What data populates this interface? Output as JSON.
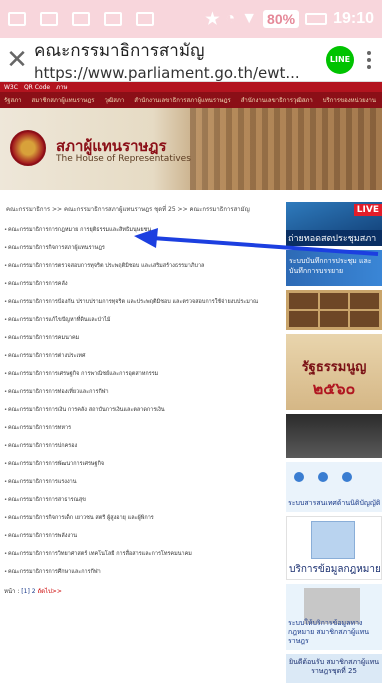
{
  "status_bar": {
    "battery": "80%",
    "time": "19:10"
  },
  "browser": {
    "page_title": "คณะกรรมาธิการสามัญ",
    "url": "https://www.parliament.go.th/ewt...",
    "line_label": "LINE"
  },
  "site": {
    "util_links": [
      "W3C",
      "QR Code",
      "ภาษ"
    ],
    "nav_items": [
      "รัฐสภา",
      "สมาชิกสภาผู้แทนราษฎร",
      "วุฒิสภา",
      "สำนักงานเลขาธิการสภาผู้แทนราษฎร",
      "สำนักงานเลขาธิการวุฒิสภา",
      "บริการของหน่วยงาน"
    ],
    "banner_th": "สภาผู้แทนราษฎร",
    "banner_en": "The House of Representatives",
    "breadcrumb": "คณะกรรมาธิการ >> คณะกรรมาธิการสภาผู้แทนราษฎร ชุดที่ 25 >> คณะกรรมาธิการสามัญ"
  },
  "committees": [
    "คณะกรรมาธิการการกฎหมาย การยุติธรรมและสิทธิมนุษยชน",
    "คณะกรรมาธิการกิจการสภาผู้แทนราษฎร",
    "คณะกรรมาธิการการตรวจสอบการทุจริต ประพฤติมิชอบ และเสริมสร้างธรรมาภิบาล",
    "คณะกรรมาธิการการคลัง",
    "คณะกรรมาธิการการป้องกัน ปราบปรามการทุจริต และประพฤติมิชอบ และตรวจสอบการใช้จ่ายงบประมาณ",
    "คณะกรรมาธิการแก้ไขปัญหาที่ดินและป่าไม้",
    "คณะกรรมาธิการการคมนาคม",
    "คณะกรรมาธิการการต่างประเทศ",
    "คณะกรรมาธิการการเศรษฐกิจ การพาณิชย์และการอุตสาหกรรม",
    "คณะกรรมาธิการการท่องเที่ยวและการกีฬา",
    "คณะกรรมาธิการการเงิน การคลัง สถาบันการเงินและตลาดการเงิน",
    "คณะกรรมาธิการการทหาร",
    "คณะกรรมาธิการการปกครอง",
    "คณะกรรมาธิการการพัฒนาการเศรษฐกิจ",
    "คณะกรรมาธิการการแรงงาน",
    "คณะกรรมาธิการการสาธารณสุข",
    "คณะกรรมาธิการกิจการเด็ก เยาวชน สตรี ผู้สูงอายุ และผู้พิการ",
    "คณะกรรมาธิการการพลังงาน",
    "คณะกรรมาธิการการวิทยาศาสตร์ เทคโนโลยี การสื่อสารและการโทรคมนาคม",
    "คณะกรรมาธิการการศึกษาและการกีฬา"
  ],
  "pagination": {
    "label": "หน้า :",
    "current": "[1]",
    "next_page": "2",
    "next_label": "ถัดไป>>"
  },
  "right_banners": {
    "live_label": "LIVE",
    "live_caption": "ถ่ายทอดสดประชุมสภา",
    "meeting_caption": "ระบบบันทึกการประชุม และบันทึกการบรรยาย",
    "constitution_l1": "รัฐธรรมนูญ",
    "constitution_l2": "๒๕๖๐",
    "law_info_caption": "ระบบสารสนเทศด้านนิติบัญญัติ",
    "data_service_caption": "บริการข้อมูลกฎหมาย",
    "law_reporting_caption": "ระบบให้บริการข้อมูลทางกฎหมาย สมาชิกสภาผู้แทนราษฎร",
    "welcome_caption": "ยินดีต้อนรับ สมาชิกสภาผู้แทนราษฎรชุดที่ 25"
  }
}
